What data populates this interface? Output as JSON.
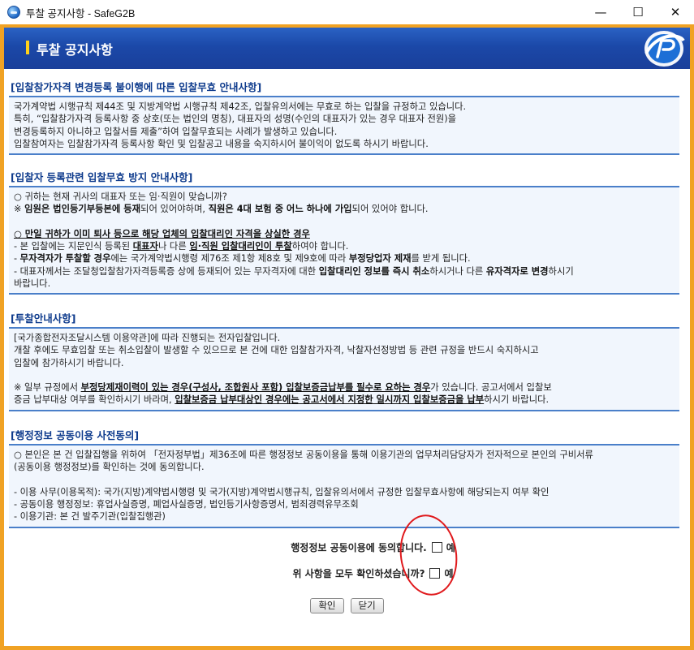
{
  "window": {
    "title": "투찰 공지사항 - SafeG2B",
    "minimize": "—",
    "maximize": "☐",
    "close": "✕"
  },
  "header": {
    "title": "투찰 공지사항"
  },
  "sections": [
    {
      "title": "[입찰참가자격 변경등록 불이행에 따른 입찰무효 안내사항]",
      "lines": [
        "국가계약법 시행규칙 제44조 및 지방계약법 시행규칙 제42조, 입찰유의서에는 무효로 하는 입찰을 규정하고 있습니다.",
        "특히, “입찰참가자격 등록사항 중 상호(또는 법인의 명칭), 대표자의 성명(수인의 대표자가 있는 경우 대표자 전원)을",
        "변경등록하지 아니하고 입찰서를 제출”하여 입찰무효되는 사례가 발생하고 있습니다.",
        "입찰참여자는 입찰참가자격 등록사항 확인 및 입찰공고 내용을 숙지하시어 불이익이 없도록 하시기 바랍니다."
      ]
    },
    {
      "title": "[입찰자 등록관련 입찰무효 방지 안내사항]",
      "l1": "○ 귀하는 현재 귀사의 대표자 또는 임·직원이 맞습니까?",
      "l2a": "※ ",
      "l2b": "임원은 법인등기부등본에 등재",
      "l2c": "되어 있어야하며, ",
      "l2d": "직원은 4대 보험 중 어느 하나에 가입",
      "l2e": "되어 있어야 합니다.",
      "l3": "○ 만일 귀하가 이미 퇴사 등으로 해당 업체의 입찰대리인 자격을 상실한 경우",
      "l4a": "- 본 입찰에는 지문인식 등록된 ",
      "l4b": "대표자",
      "l4c": "나 다른 ",
      "l4d": "임·직원 입찰대리인이 투찰",
      "l4e": "하여야 합니다.",
      "l5a": "- ",
      "l5b": "무자격자가 투찰할 경우",
      "l5c": "에는 국가계약법시행령 제76조 제1항 제8호 및 제9호에 따라 ",
      "l5d": "부정당업자 제재",
      "l5e": "를 받게 됩니다.",
      "l6a": "- 대표자께서는 조달청입찰참가자격등록증 상에 등재되어 있는 무자격자에 대한 ",
      "l6b": "입찰대리인 정보를 즉시 취소",
      "l6c": "하시거나 다른 ",
      "l6d": "유자격자로 변경",
      "l6e": "하시기",
      "l7": "바랍니다."
    },
    {
      "title": "[투찰안내사항]",
      "l1": "[국가종합전자조달시스템 이용약관]에 따라 진행되는 전자입찰입니다.",
      "l2": "개찰 후에도 무효입찰 또는 취소입찰이 발생할 수 있으므로 본 건에 대한 입찰참가자격, 낙찰자선정방법 등 관련 규정을 반드시 숙지하시고",
      "l3": "입찰에 참가하시기 바랍니다.",
      "l4a": "※ 일부 규정에서 ",
      "l4b": "부정당제재이력이 있는 경우(구성사, 조합원사 포함) 입찰보증금납부를 필수로 요하는 경우",
      "l4c": "가 있습니다. 공고서에서 입찰보",
      "l5a": "증금 납부대상 여부를 확인하시기 바라며, ",
      "l5b": "입찰보증금 납부대상인 경우에는 공고서에서 지정한 일시까지 입찰보증금을 납부",
      "l5c": "하시기 바랍니다."
    },
    {
      "title": "[행정정보 공동이용 사전동의]",
      "l1": "○ 본인은 본 건 입찰집행을 위하여 「전자정부법」제36조에 따른 행정정보 공동이용을 통해 이용기관의 업무처리담당자가 전자적으로 본인의 구비서류",
      "l2": "(공동이용 행정정보)를 확인하는 것에 동의합니다.",
      "l3": "- 이용 사무(이용목적): 국가(지방)계약법시행령 및 국가(지방)계약법시행규칙, 입찰유의서에서 규정한 입찰무효사항에 해당되는지 여부 확인",
      "l4": "- 공동이용 행정정보: 휴업사실증명, 폐업사실증명, 법인등기사항증명서, 범죄경력유무조회",
      "l5": "- 이용기관: 본 건 발주기관(입찰집행관)"
    }
  ],
  "agree": {
    "q1": "행정정보 공동이용에 동의합니다.",
    "q2": "위 사항을 모두 확인하셨습니까?",
    "yes": "예",
    "q1_checked": false,
    "q2_checked": false
  },
  "buttons": {
    "confirm": "확인",
    "close": "닫기"
  },
  "colors": {
    "frame": "#f0a224",
    "header": "#1b48a8",
    "section_title": "#0d3a8c",
    "annotation": "#e0191c"
  }
}
